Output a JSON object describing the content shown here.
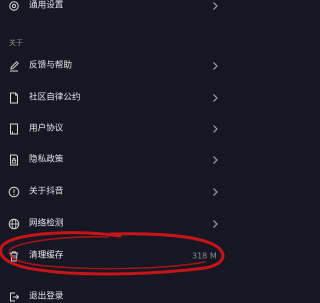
{
  "top_item": {
    "label": "通用设置",
    "icon": "gear-icon"
  },
  "section": {
    "title": "关于"
  },
  "items": [
    {
      "label": "反馈与帮助",
      "icon": "edit-icon"
    },
    {
      "label": "社区自律公约",
      "icon": "document-icon"
    },
    {
      "label": "用户协议",
      "icon": "book-icon"
    },
    {
      "label": "隐私政策",
      "icon": "privacy-document-icon"
    },
    {
      "label": "关于抖音",
      "icon": "info-icon"
    },
    {
      "label": "网络检测",
      "icon": "globe-icon"
    }
  ],
  "clear_cache": {
    "label": "清理缓存",
    "value": "318 M",
    "icon": "trash-icon"
  },
  "logout": {
    "label": "退出登录",
    "icon": "logout-icon"
  },
  "colors": {
    "background": "#161722",
    "text": "#e6e6ea",
    "muted": "#8d8e97",
    "annotation": "#c7141a"
  }
}
